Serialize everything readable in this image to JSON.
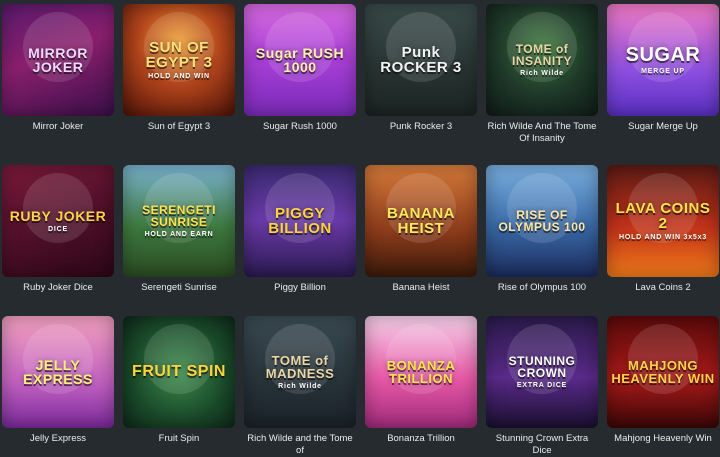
{
  "games": [
    {
      "title": "Mirror Joker",
      "art": "MIRROR JOKER",
      "bg": "linear-gradient(160deg,#5b1a6e 0%,#8a1f6d 45%,#3a0f4a 100%)",
      "color": "#f3d7ff",
      "size": 14
    },
    {
      "title": "Sun of Egypt 3",
      "art": "SUN OF EGYPT 3",
      "sub": "HOLD AND WIN",
      "bg": "radial-gradient(circle at 50% 35%,#f0a035 0%,#b2451c 45%,#4c1208 100%)",
      "color": "#ffe07a",
      "size": 15
    },
    {
      "title": "Sugar Rush 1000",
      "art": "Sugar RUSH 1000",
      "bg": "linear-gradient(180deg,#d66ae0 0%,#a83fd6 50%,#7a2ab8 100%)",
      "color": "#fff1a8",
      "size": 14
    },
    {
      "title": "Punk Rocker 3",
      "art": "Punk ROCKER 3",
      "bg": "linear-gradient(180deg,#3a4b4a 0%,#1b2422 100%)",
      "color": "#f2f2f2",
      "size": 15
    },
    {
      "title": "Rich Wilde And The Tome Of Insanity",
      "art": "TOME of INSANITY",
      "sub": "Rich Wilde",
      "bg": "radial-gradient(circle at 50% 40%,#3c7a3a 0%,#1f3a2a 50%,#101a16 100%)",
      "color": "#e8d7a8",
      "size": 12
    },
    {
      "title": "Sugar Merge Up",
      "art": "SUGAR",
      "sub": "MERGE UP",
      "bg": "linear-gradient(180deg,#f07ac6 0%,#8c4fe0 60%,#5a2fc0 100%)",
      "color": "#ffffff",
      "size": 20
    },
    {
      "title": "Ruby Joker Dice",
      "art": "RUBY JOKER",
      "sub": "DICE",
      "bg": "linear-gradient(160deg,#7a1a3a 0%,#4a0e26 60%,#2c0716 100%)",
      "color": "#ffd24a",
      "size": 14
    },
    {
      "title": "Serengeti Sunrise",
      "art": "SERENGETI SUNRISE",
      "sub": "HOLD AND EARN",
      "bg": "linear-gradient(180deg,#7ab3d0 0%,#3e7a3f 55%,#2a4a22 100%)",
      "color": "#ffe24a",
      "size": 12
    },
    {
      "title": "Piggy Billion",
      "art": "PIGGY BILLION",
      "bg": "linear-gradient(180deg,#3a2a70 0%,#6a3aa8 50%,#2a1a50 100%)",
      "color": "#ffd23a",
      "size": 15
    },
    {
      "title": "Banana Heist",
      "art": "BANANA HEIST",
      "bg": "linear-gradient(180deg,#d67a3a 0%,#8a3a1a 60%,#3a1a0a 100%)",
      "color": "#ffe65a",
      "size": 15
    },
    {
      "title": "Rise of Olympus 100",
      "art": "RISE OF OLYMPUS 100",
      "bg": "linear-gradient(180deg,#7ab0e0 0%,#3a6aa8 55%,#1a2a5a 100%)",
      "color": "#ffe7a0",
      "size": 12
    },
    {
      "title": "Lava Coins 2",
      "art": "LAVA COINS 2",
      "sub": "HOLD AND WIN 3x5x3",
      "bg": "linear-gradient(180deg,#5a1a14 0%,#c2321a 55%,#f07a1a 100%)",
      "color": "#ffe24a",
      "size": 15
    },
    {
      "title": "Jelly Express",
      "art": "JELLY EXPRESS",
      "bg": "linear-gradient(180deg,#f2a0c0 0%,#c060c0 60%,#7a2a9a 100%)",
      "color": "#fff07a",
      "size": 14
    },
    {
      "title": "Fruit Spin",
      "art": "FRUIT SPIN",
      "bg": "radial-gradient(circle at 50% 50%,#3a8a4a 0%,#1a4a2a 60%,#0e2818 100%)",
      "color": "#ffd43a",
      "size": 16
    },
    {
      "title": "Rich Wilde and the Tome of",
      "art": "TOME of MADNESS",
      "sub": "Rich Wilde",
      "bg": "linear-gradient(180deg,#3a4a52 0%,#1a2228 100%)",
      "color": "#e8d7a8",
      "size": 13
    },
    {
      "title": "Bonanza Trillion",
      "art": "BONANZA TRILLION",
      "bg": "linear-gradient(180deg,#f5d0e8 0%,#e85aa8 55%,#a02a7a 100%)",
      "color": "#ffe24a",
      "size": 13
    },
    {
      "title": "Stunning Crown Extra Dice",
      "art": "STUNNING CROWN",
      "sub": "EXTRA DICE",
      "bg": "linear-gradient(180deg,#2a1a4a 0%,#5a2a8a 55%,#1a1030 100%)",
      "color": "#ffffff",
      "size": 12
    },
    {
      "title": "Mahjong Heavenly Win",
      "art": "MAHJONG HEAVENLY WIN",
      "bg": "linear-gradient(180deg,#5a0a0a 0%,#a81a1a 55%,#3a0606 100%)",
      "color": "#ffd24a",
      "size": 13
    }
  ]
}
